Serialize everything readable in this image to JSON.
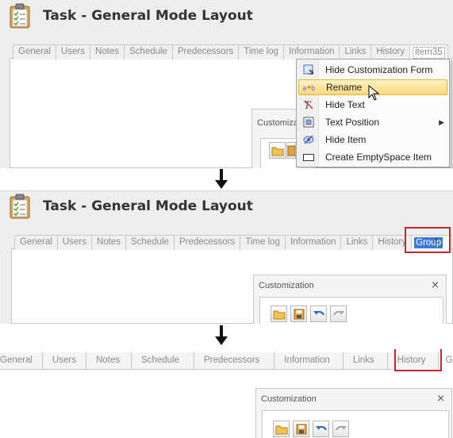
{
  "window_title": "Task - General Mode Layout",
  "tabs_step1": [
    "General",
    "Users",
    "Notes",
    "Schedule",
    "Predecessors",
    "Time log",
    "Information",
    "Links",
    "History",
    "item35"
  ],
  "tabs_step2": [
    "General",
    "Users",
    "Notes",
    "Schedule",
    "Predecessors",
    "Time log",
    "Information",
    "Links",
    "History"
  ],
  "tab_editing_text": "Group",
  "tabs_step3": [
    "General",
    "Users",
    "Notes",
    "Schedule",
    "Predecessors",
    "Information",
    "Links",
    "History",
    "Group"
  ],
  "customization_title": "Customization",
  "customization_partial": "Customiza",
  "context_menu": [
    {
      "label": "Hide Customization Form",
      "icon": "customize-form-icon"
    },
    {
      "label": "Rename",
      "icon": "rename-icon"
    },
    {
      "label": "Hide Text",
      "icon": "hide-text-icon"
    },
    {
      "label": "Text Position",
      "icon": "text-position-icon",
      "submenu": true
    },
    {
      "label": "Hide Item",
      "icon": "hide-item-icon"
    },
    {
      "label": "Create EmptySpace Item",
      "icon": "empty-space-icon"
    }
  ],
  "colors": {
    "selection": "#3b7bd6",
    "highlight_box": "#c0272d",
    "menu_hover": "#f8d87a"
  }
}
